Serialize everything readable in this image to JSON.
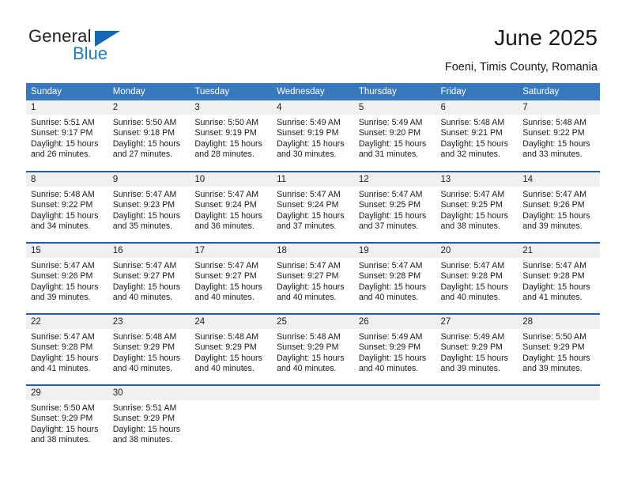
{
  "brand": {
    "name_part1": "General",
    "name_part2": "Blue",
    "triangle_color": "#1268b3",
    "blue_color": "#1a7bc4"
  },
  "header": {
    "title": "June 2025",
    "subtitle": "Foeni, Timis County, Romania"
  },
  "theme": {
    "header_bg": "#3879bd",
    "row_divider": "#1f5fa9",
    "daynum_bg": "#f0f0f0",
    "text": "#1a1a1a"
  },
  "weekdays": [
    "Sunday",
    "Monday",
    "Tuesday",
    "Wednesday",
    "Thursday",
    "Friday",
    "Saturday"
  ],
  "labels": {
    "sunrise_prefix": "Sunrise:",
    "sunset_prefix": "Sunset:",
    "daylight_prefix": "Daylight:"
  },
  "weeks": [
    [
      {
        "day": "1",
        "sunrise": "Sunrise: 5:51 AM",
        "sunset": "Sunset: 9:17 PM",
        "daylight1": "Daylight: 15 hours",
        "daylight2": "and 26 minutes."
      },
      {
        "day": "2",
        "sunrise": "Sunrise: 5:50 AM",
        "sunset": "Sunset: 9:18 PM",
        "daylight1": "Daylight: 15 hours",
        "daylight2": "and 27 minutes."
      },
      {
        "day": "3",
        "sunrise": "Sunrise: 5:50 AM",
        "sunset": "Sunset: 9:19 PM",
        "daylight1": "Daylight: 15 hours",
        "daylight2": "and 28 minutes."
      },
      {
        "day": "4",
        "sunrise": "Sunrise: 5:49 AM",
        "sunset": "Sunset: 9:19 PM",
        "daylight1": "Daylight: 15 hours",
        "daylight2": "and 30 minutes."
      },
      {
        "day": "5",
        "sunrise": "Sunrise: 5:49 AM",
        "sunset": "Sunset: 9:20 PM",
        "daylight1": "Daylight: 15 hours",
        "daylight2": "and 31 minutes."
      },
      {
        "day": "6",
        "sunrise": "Sunrise: 5:48 AM",
        "sunset": "Sunset: 9:21 PM",
        "daylight1": "Daylight: 15 hours",
        "daylight2": "and 32 minutes."
      },
      {
        "day": "7",
        "sunrise": "Sunrise: 5:48 AM",
        "sunset": "Sunset: 9:22 PM",
        "daylight1": "Daylight: 15 hours",
        "daylight2": "and 33 minutes."
      }
    ],
    [
      {
        "day": "8",
        "sunrise": "Sunrise: 5:48 AM",
        "sunset": "Sunset: 9:22 PM",
        "daylight1": "Daylight: 15 hours",
        "daylight2": "and 34 minutes."
      },
      {
        "day": "9",
        "sunrise": "Sunrise: 5:47 AM",
        "sunset": "Sunset: 9:23 PM",
        "daylight1": "Daylight: 15 hours",
        "daylight2": "and 35 minutes."
      },
      {
        "day": "10",
        "sunrise": "Sunrise: 5:47 AM",
        "sunset": "Sunset: 9:24 PM",
        "daylight1": "Daylight: 15 hours",
        "daylight2": "and 36 minutes."
      },
      {
        "day": "11",
        "sunrise": "Sunrise: 5:47 AM",
        "sunset": "Sunset: 9:24 PM",
        "daylight1": "Daylight: 15 hours",
        "daylight2": "and 37 minutes."
      },
      {
        "day": "12",
        "sunrise": "Sunrise: 5:47 AM",
        "sunset": "Sunset: 9:25 PM",
        "daylight1": "Daylight: 15 hours",
        "daylight2": "and 37 minutes."
      },
      {
        "day": "13",
        "sunrise": "Sunrise: 5:47 AM",
        "sunset": "Sunset: 9:25 PM",
        "daylight1": "Daylight: 15 hours",
        "daylight2": "and 38 minutes."
      },
      {
        "day": "14",
        "sunrise": "Sunrise: 5:47 AM",
        "sunset": "Sunset: 9:26 PM",
        "daylight1": "Daylight: 15 hours",
        "daylight2": "and 39 minutes."
      }
    ],
    [
      {
        "day": "15",
        "sunrise": "Sunrise: 5:47 AM",
        "sunset": "Sunset: 9:26 PM",
        "daylight1": "Daylight: 15 hours",
        "daylight2": "and 39 minutes."
      },
      {
        "day": "16",
        "sunrise": "Sunrise: 5:47 AM",
        "sunset": "Sunset: 9:27 PM",
        "daylight1": "Daylight: 15 hours",
        "daylight2": "and 40 minutes."
      },
      {
        "day": "17",
        "sunrise": "Sunrise: 5:47 AM",
        "sunset": "Sunset: 9:27 PM",
        "daylight1": "Daylight: 15 hours",
        "daylight2": "and 40 minutes."
      },
      {
        "day": "18",
        "sunrise": "Sunrise: 5:47 AM",
        "sunset": "Sunset: 9:27 PM",
        "daylight1": "Daylight: 15 hours",
        "daylight2": "and 40 minutes."
      },
      {
        "day": "19",
        "sunrise": "Sunrise: 5:47 AM",
        "sunset": "Sunset: 9:28 PM",
        "daylight1": "Daylight: 15 hours",
        "daylight2": "and 40 minutes."
      },
      {
        "day": "20",
        "sunrise": "Sunrise: 5:47 AM",
        "sunset": "Sunset: 9:28 PM",
        "daylight1": "Daylight: 15 hours",
        "daylight2": "and 40 minutes."
      },
      {
        "day": "21",
        "sunrise": "Sunrise: 5:47 AM",
        "sunset": "Sunset: 9:28 PM",
        "daylight1": "Daylight: 15 hours",
        "daylight2": "and 41 minutes."
      }
    ],
    [
      {
        "day": "22",
        "sunrise": "Sunrise: 5:47 AM",
        "sunset": "Sunset: 9:28 PM",
        "daylight1": "Daylight: 15 hours",
        "daylight2": "and 41 minutes."
      },
      {
        "day": "23",
        "sunrise": "Sunrise: 5:48 AM",
        "sunset": "Sunset: 9:29 PM",
        "daylight1": "Daylight: 15 hours",
        "daylight2": "and 40 minutes."
      },
      {
        "day": "24",
        "sunrise": "Sunrise: 5:48 AM",
        "sunset": "Sunset: 9:29 PM",
        "daylight1": "Daylight: 15 hours",
        "daylight2": "and 40 minutes."
      },
      {
        "day": "25",
        "sunrise": "Sunrise: 5:48 AM",
        "sunset": "Sunset: 9:29 PM",
        "daylight1": "Daylight: 15 hours",
        "daylight2": "and 40 minutes."
      },
      {
        "day": "26",
        "sunrise": "Sunrise: 5:49 AM",
        "sunset": "Sunset: 9:29 PM",
        "daylight1": "Daylight: 15 hours",
        "daylight2": "and 40 minutes."
      },
      {
        "day": "27",
        "sunrise": "Sunrise: 5:49 AM",
        "sunset": "Sunset: 9:29 PM",
        "daylight1": "Daylight: 15 hours",
        "daylight2": "and 39 minutes."
      },
      {
        "day": "28",
        "sunrise": "Sunrise: 5:50 AM",
        "sunset": "Sunset: 9:29 PM",
        "daylight1": "Daylight: 15 hours",
        "daylight2": "and 39 minutes."
      }
    ],
    [
      {
        "day": "29",
        "sunrise": "Sunrise: 5:50 AM",
        "sunset": "Sunset: 9:29 PM",
        "daylight1": "Daylight: 15 hours",
        "daylight2": "and 38 minutes."
      },
      {
        "day": "30",
        "sunrise": "Sunrise: 5:51 AM",
        "sunset": "Sunset: 9:29 PM",
        "daylight1": "Daylight: 15 hours",
        "daylight2": "and 38 minutes."
      },
      {
        "day": "",
        "sunrise": "",
        "sunset": "",
        "daylight1": "",
        "daylight2": ""
      },
      {
        "day": "",
        "sunrise": "",
        "sunset": "",
        "daylight1": "",
        "daylight2": ""
      },
      {
        "day": "",
        "sunrise": "",
        "sunset": "",
        "daylight1": "",
        "daylight2": ""
      },
      {
        "day": "",
        "sunrise": "",
        "sunset": "",
        "daylight1": "",
        "daylight2": ""
      },
      {
        "day": "",
        "sunrise": "",
        "sunset": "",
        "daylight1": "",
        "daylight2": ""
      }
    ]
  ]
}
